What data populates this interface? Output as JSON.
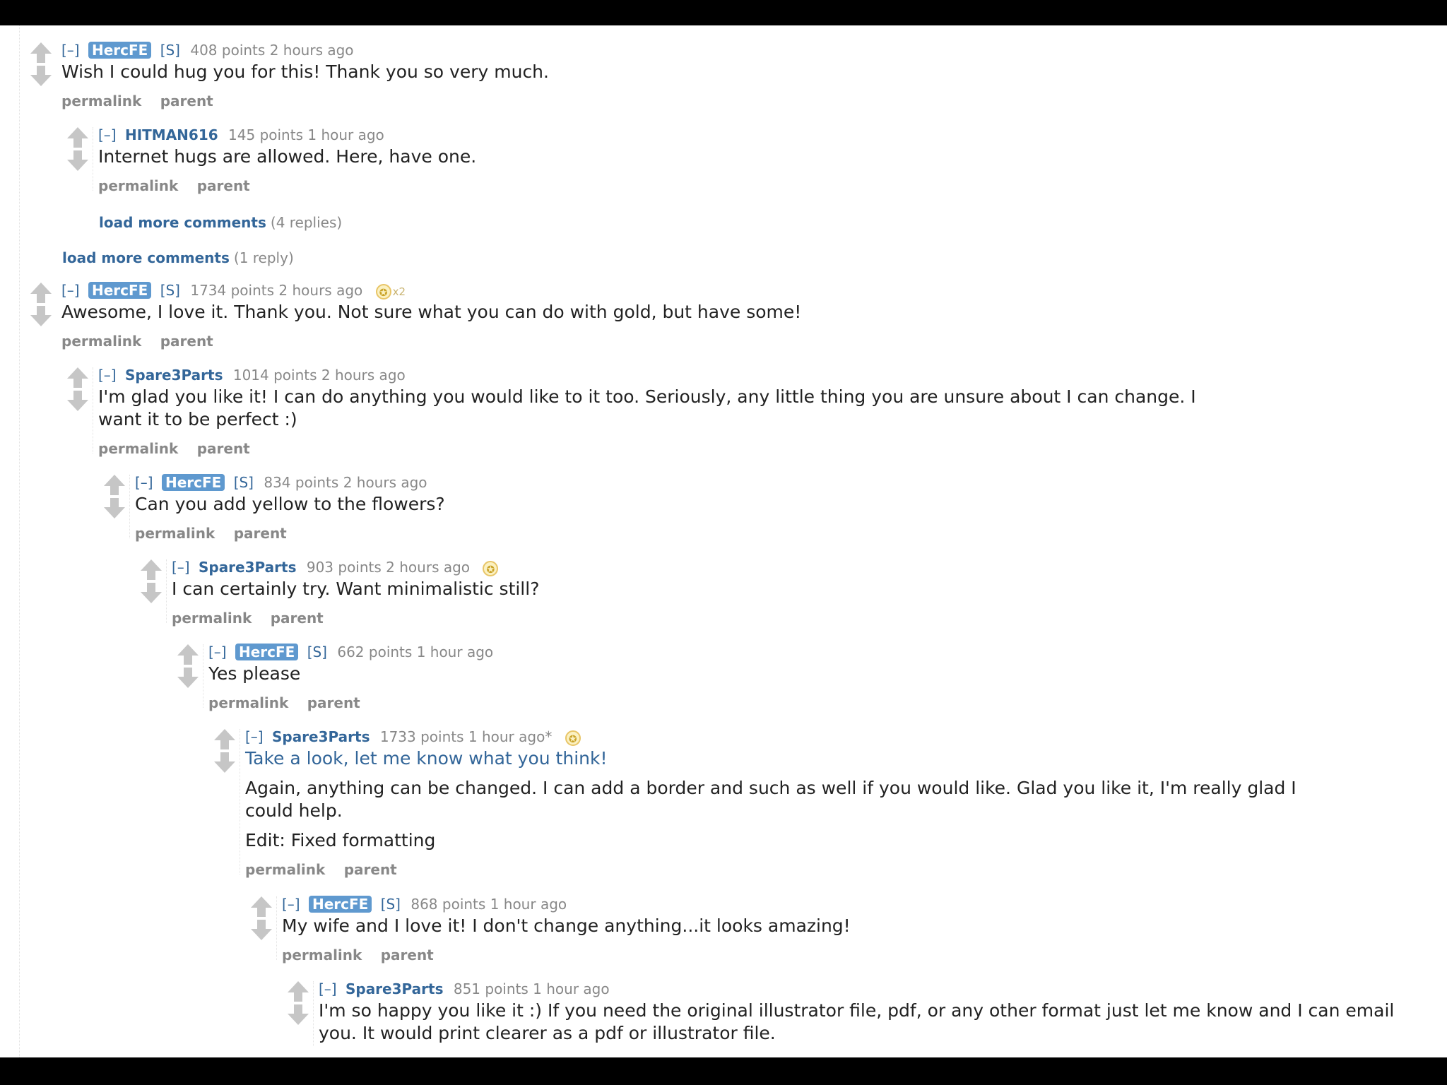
{
  "labels": {
    "expand": "[–]",
    "submitter": "[S]",
    "permalink": "permalink",
    "parent": "parent",
    "gilded_icon": "gold-star-icon"
  },
  "comments": [
    {
      "author": "HercFE",
      "op": true,
      "score": "408 points",
      "time": "2 hours ago",
      "body": [
        "Wish I could hug you for this! Thank you so very much."
      ]
    },
    {
      "author": "HITMAN616",
      "op": false,
      "score": "145 points",
      "time": "1 hour ago",
      "body": [
        "Internet hugs are allowed. Here, have one."
      ]
    },
    {
      "author": "HercFE",
      "op": true,
      "score": "1734 points",
      "time": "2 hours ago",
      "gilded": "x2",
      "body": [
        "Awesome, I love it. Thank you. Not sure what you can do with gold, but have some!"
      ]
    },
    {
      "author": "Spare3Parts",
      "op": false,
      "score": "1014 points",
      "time": "2 hours ago",
      "body": [
        "I'm glad you like it! I can do anything you would like to it too. Seriously, any little thing you are unsure about I can change. I want it to be perfect :)"
      ]
    },
    {
      "author": "HercFE",
      "op": true,
      "score": "834 points",
      "time": "2 hours ago",
      "body": [
        "Can you add yellow to the flowers?"
      ]
    },
    {
      "author": "Spare3Parts",
      "op": false,
      "score": "903 points",
      "time": "2 hours ago",
      "gilded": "",
      "body": [
        "I can certainly try. Want minimalistic still?"
      ]
    },
    {
      "author": "HercFE",
      "op": true,
      "score": "662 points",
      "time": "1 hour ago",
      "body": [
        "Yes please"
      ]
    },
    {
      "author": "Spare3Parts",
      "op": false,
      "score": "1733 points",
      "time": "1 hour ago*",
      "gilded": "",
      "body": [
        "Take a look, let me know what you think!",
        "Again, anything can be changed. I can add a border and such as well if you would like. Glad you like it, I'm really glad I could help.",
        "Edit: Fixed formatting"
      ]
    },
    {
      "author": "HercFE",
      "op": true,
      "score": "868 points",
      "time": "1 hour ago",
      "body": [
        "My wife and I love it! I don't change anything...it looks amazing!"
      ]
    },
    {
      "author": "Spare3Parts",
      "op": false,
      "score": "851 points",
      "time": "1 hour ago",
      "body": [
        "I'm so happy you like it :) If you need the original illustrator file, pdf, or any other format just let me know and I can email you. It would print clearer as a pdf or illustrator file."
      ]
    }
  ],
  "more_comments": [
    {
      "label": "load more comments",
      "count": "(4 replies)"
    },
    {
      "label": "load more comments",
      "count": "(1 reply)"
    }
  ]
}
